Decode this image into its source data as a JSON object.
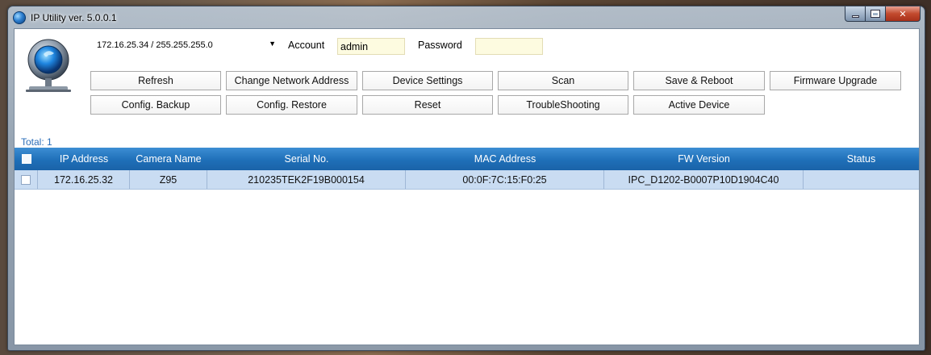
{
  "window": {
    "title": "IP Utility ver. 5.0.0.1"
  },
  "toolbar": {
    "network_value": "172.16.25.34 / 255.255.255.0",
    "account_label": "Account",
    "account_value": "admin",
    "password_label": "Password",
    "password_value": "",
    "buttons_row1": [
      "Refresh",
      "Change Network Address",
      "Device Settings",
      "Scan",
      "Save & Reboot",
      "Firmware Upgrade"
    ],
    "buttons_row2": [
      "Config. Backup",
      "Config. Restore",
      "Reset",
      "TroubleShooting",
      "Active Device"
    ]
  },
  "summary": {
    "total": "Total: 1"
  },
  "table": {
    "columns": [
      "IP Address",
      "Camera Name",
      "Serial No.",
      "MAC Address",
      "FW Version",
      "Status"
    ],
    "rows": [
      [
        "172.16.25.32",
        "Z95",
        "210235TEK2F19B000154",
        "00:0F:7C:15:F0:25",
        "IPC_D1202-B0007P10D1904C40",
        ""
      ]
    ]
  },
  "colors": {
    "header_blue": "#1f6fb8",
    "row_selected": "#c9dcf2",
    "total_text": "#2a6db8",
    "field_bg": "#fdfbe0"
  }
}
